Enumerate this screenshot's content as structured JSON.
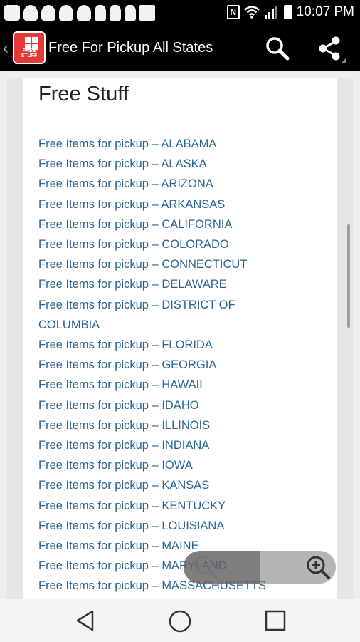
{
  "status_bar": {
    "time": "10:07 PM",
    "nfc_label": "N"
  },
  "app_bar": {
    "title": "Free For Pickup All States",
    "logo_text": "FREE STUFF",
    "brand_color": "#e53935"
  },
  "page": {
    "title": "Free Stuff",
    "link_color": "#2a6496",
    "links": [
      "Free Items for pickup  – ALABAMA",
      "Free Items for pickup  – ALASKA",
      "Free Items for pickup  – ARIZONA",
      "Free Items for pickup  – ARKANSAS",
      "Free Items for pickup  – CALIFORNIA",
      "Free Items for pickup  – COLORADO",
      "Free Items for pickup  – CONNECTICUT",
      "Free Items for pickup  – DELAWARE",
      "Free Items for pickup  – DISTRICT OF COLUMBIA",
      "Free Items for pickup  – FLORIDA",
      "Free Items for pickup  – GEORGIA",
      "Free Items for pickup  – HAWAII",
      "Free Items for pickup  – IDAHO",
      "Free Items for pickup  – ILLINOIS",
      "Free Items for pickup  – INDIANA",
      "Free Items for pickup  – IOWA",
      "Free Items for pickup  – KANSAS",
      "Free Items for pickup  – KENTUCKY",
      "Free Items for pickup  – LOUISIANA",
      "Free Items for pickup  – MAINE",
      "Free Items for pickup  – MARYLAND",
      "Free Items for pickup  – MASSACHUSETTS"
    ]
  },
  "icons": {
    "search": "search-icon",
    "share": "share-icon",
    "zoom_out": "zoom-out-icon",
    "zoom_in": "zoom-in-icon",
    "nav_back": "nav-back-icon",
    "nav_home": "nav-home-icon",
    "nav_recent": "nav-recent-apps-icon"
  }
}
